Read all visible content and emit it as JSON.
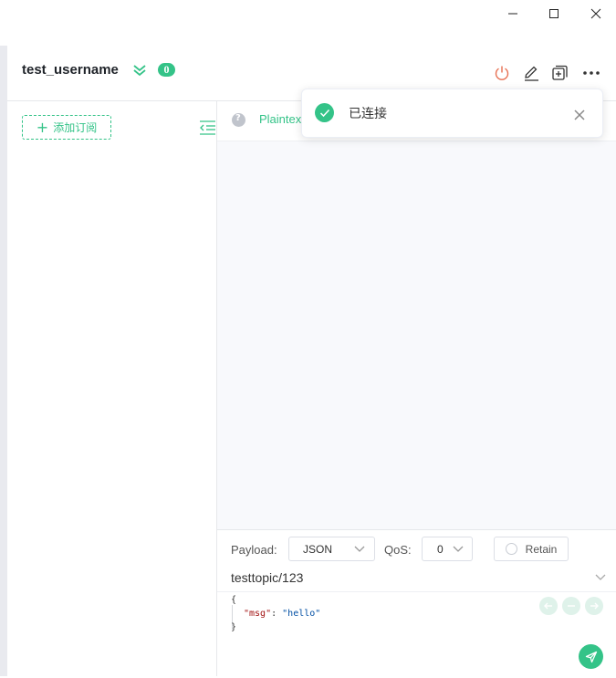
{
  "window": {
    "minimize_icon": "minimize-icon",
    "maximize_icon": "maximize-icon",
    "close_icon": "close-icon"
  },
  "header": {
    "title": "test_username",
    "collapse_icon": "double-chevron-down-icon",
    "badge_count": "0",
    "actions": [
      "power-icon",
      "edit-icon",
      "new-window-icon",
      "more-icon"
    ]
  },
  "sidebar": {
    "add_subscription_label": "添加订阅",
    "collapse_icon": "collapse-list-icon"
  },
  "topbar": {
    "format_label": "Plaintext"
  },
  "toast": {
    "message": "已连接"
  },
  "publish": {
    "payload_label": "Payload:",
    "payload_format": "JSON",
    "qos_label": "QoS:",
    "qos_value": "0",
    "retain_label": "Retain",
    "topic": "testtopic/123",
    "code_line1": "{",
    "code_key": "\"msg\"",
    "code_colon": ": ",
    "code_value": "\"hello\"",
    "code_line3": "}"
  },
  "colors": {
    "accent": "#34c388",
    "danger": "#e76f51",
    "message_bg": "#f8f9fc"
  }
}
